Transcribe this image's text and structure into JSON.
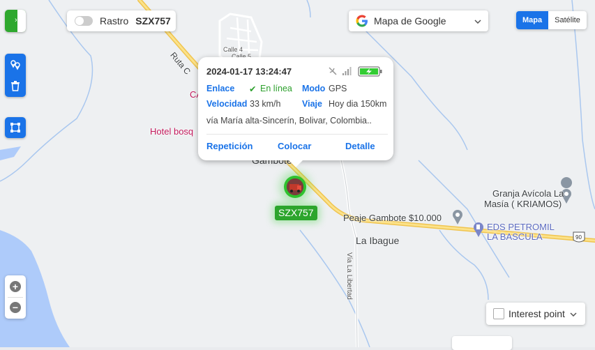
{
  "map": {
    "labels": {
      "calle4": "Calle 4",
      "calle5": "Calle 5",
      "ruta": "Ruta C",
      "ca": "CA",
      "hotel": "Hotel bosq",
      "gambote": "Gambote",
      "peaje": "Peaje Gambote $10.000",
      "granja_line1": "Granja Avícola La",
      "granja_line2": "Masía ( KRIAMOS)",
      "eds_line1": "EDS PETROMIL",
      "eds_line2": "LA BASCULA",
      "ibague": "La Ibague",
      "via_libertad": "Vía La Libertad",
      "route_shield": "90"
    }
  },
  "toolbar": {
    "rastro_label": "Rastro",
    "rastro_plate": "SZX757",
    "rastro_enabled": false,
    "map_provider": "Mapa de Google",
    "map_tab": "Mapa",
    "satellite_tab": "Satélite",
    "active_tab": "Mapa"
  },
  "popup": {
    "datetime": "2024-01-17 13:24:47",
    "enlace_label": "Enlace",
    "enlace_value": "En línea",
    "modo_label": "Modo",
    "modo_value": "GPS",
    "velocidad_label": "Velocidad",
    "velocidad_value": "33 km/h",
    "viaje_label": "Viaje",
    "viaje_value": "Hoy dia 150km",
    "address": "vía María alta-Sincerín, Bolivar, Colombia..",
    "actions": {
      "repeticion": "Repetición",
      "colocar": "Colocar",
      "detalle": "Detalle"
    }
  },
  "vehicle": {
    "plate": "SZX757"
  },
  "controls": {
    "zoom_in": "+",
    "zoom_out": "−",
    "interest_point": "Interest point",
    "interest_checked": false
  },
  "colors": {
    "accent": "#1a73e8",
    "online": "#2ca02c",
    "vehicle": "#2fc22f"
  }
}
